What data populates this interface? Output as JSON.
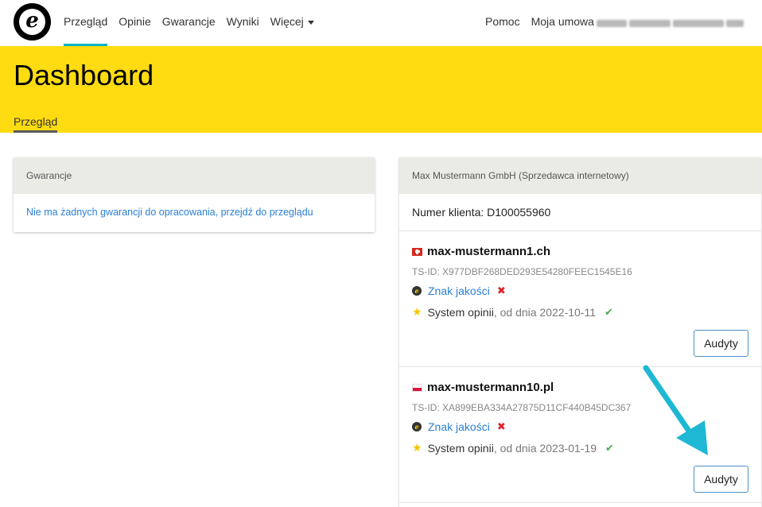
{
  "nav": {
    "logo_letter": "e",
    "items": [
      {
        "label": "Przegląd",
        "active": true
      },
      {
        "label": "Opinie"
      },
      {
        "label": "Gwarancje"
      },
      {
        "label": "Wyniki"
      },
      {
        "label": "Więcej",
        "has_dropdown": true
      }
    ],
    "right": [
      {
        "label": "Pomoc"
      },
      {
        "label": "Moja umowa"
      }
    ]
  },
  "header": {
    "title": "Dashboard",
    "tab": "Przegląd",
    "background": "#fedc11"
  },
  "guarantees_card": {
    "title": "Gwarancje",
    "message": "Nie ma żadnych gwarancji do opracowania, przejdź do przeglądu"
  },
  "company_card": {
    "title": "Max Mustermann GmbH (Sprzedawca internetowy)",
    "client_number": "Numer klienta: D100055960",
    "shops": [
      {
        "flag": "ch-flag-icon",
        "name": "max-mustermann1.ch",
        "tsid": "TS-ID: X977DBF268DED293E54280FEEC1545E16",
        "quality_label": "Znak jakości",
        "quality_status": "✖",
        "reviews_label": "System opinii",
        "reviews_since": ", od dnia 2022-10-11",
        "reviews_status": "✔",
        "audit_label": "Audyty"
      },
      {
        "flag": "pl-flag-icon",
        "name": "max-mustermann10.pl",
        "tsid": "TS-ID: XA899EBA334A27875D11CF440B45DC367",
        "quality_label": "Znak jakości",
        "quality_status": "✖",
        "reviews_label": "System opinii",
        "reviews_since": ", od dnia 2023-01-19",
        "reviews_status": "✔",
        "audit_label": "Audyty"
      }
    ]
  },
  "colors": {
    "accent": "#00b3c6",
    "link": "#2a7fd4",
    "error": "#d9232d",
    "success": "#4cae4c",
    "arrow": "#1fb8d4"
  }
}
